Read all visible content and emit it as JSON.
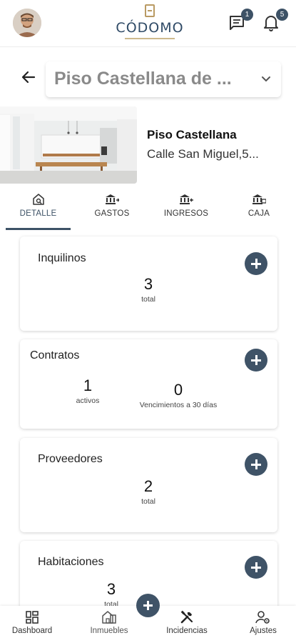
{
  "header": {
    "logo_text": "CÓDOMO",
    "messages_badge": "1",
    "notifications_badge": "5"
  },
  "selector": {
    "value": "Piso Castellana de ..."
  },
  "property": {
    "name": "Piso Castellana",
    "address": "Calle San Miguel,5..."
  },
  "tabs": [
    {
      "label": "DETALLE",
      "icon": "house-search-icon",
      "active": true
    },
    {
      "label": "GASTOS",
      "icon": "bank-out-icon",
      "active": false
    },
    {
      "label": "INGRESOS",
      "icon": "bank-in-icon",
      "active": false
    },
    {
      "label": "CAJA",
      "icon": "cash-box-icon",
      "active": false
    }
  ],
  "cards": {
    "inquilinos": {
      "title": "Inquilinos",
      "value": "3",
      "label": "total"
    },
    "contratos": {
      "title": "Contratos",
      "stats": [
        {
          "value": "1",
          "label": "activos"
        },
        {
          "value": "0",
          "label": "Vencimientos a 30 días"
        }
      ]
    },
    "proveedores": {
      "title": "Proveedores",
      "value": "2",
      "label": "total"
    },
    "habitaciones": {
      "title": "Habitaciones",
      "value": "3",
      "label": "total"
    }
  },
  "bottom_nav": [
    {
      "label": "Dashboard",
      "icon": "dashboard-icon"
    },
    {
      "label": "Inmuebles",
      "icon": "building-icon"
    },
    {
      "label": "Incidencias",
      "icon": "tools-icon"
    },
    {
      "label": "Ajustes",
      "icon": "user-settings-icon"
    }
  ],
  "colors": {
    "accent": "#3f5367",
    "gold": "#b99a63"
  }
}
